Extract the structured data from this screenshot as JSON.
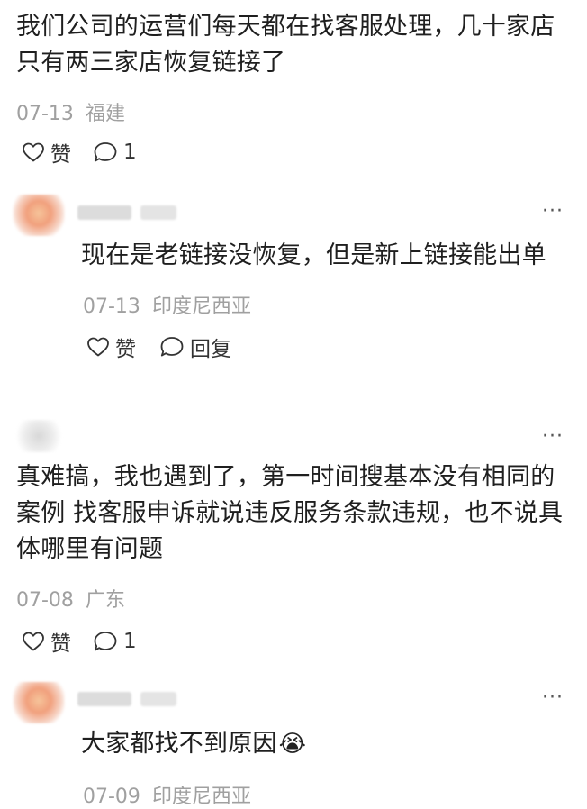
{
  "comments": [
    {
      "text": "我们公司的运营们每天都在找客服处理，几十家店只有两三家店恢复链接了",
      "date": "07-13",
      "location": "福建",
      "like_label": "赞",
      "reply_count": "1",
      "replies": [
        {
          "text": "现在是老链接没恢复，但是新上链接能出单",
          "date": "07-13",
          "location": "印度尼西亚",
          "like_label": "赞",
          "reply_label": "回复",
          "more_label": "···"
        }
      ],
      "reply_more_label": "···"
    },
    {
      "text": "真难搞，我也遇到了，第一时间搜基本没有相同的案例 找客服申诉就说违反服务条款违规，也不说具体哪里有问题",
      "date": "07-08",
      "location": "广东",
      "like_label": "赞",
      "reply_count": "1",
      "more_label": "···",
      "replies": [
        {
          "text": "大家都找不到原因",
          "emoji": "😭",
          "date": "07-09",
          "location": "印度尼西亚",
          "more_label": "···"
        }
      ]
    }
  ],
  "colors": {
    "text": "#1f1f1f",
    "meta": "#a0a0a0",
    "avatar_blur_orange": "#f3b07a",
    "avatar_blur_red": "#ef8a7a"
  },
  "icons": {
    "like": "heart-outline-icon",
    "comment": "speech-bubble-icon",
    "more": "ellipsis-icon"
  }
}
